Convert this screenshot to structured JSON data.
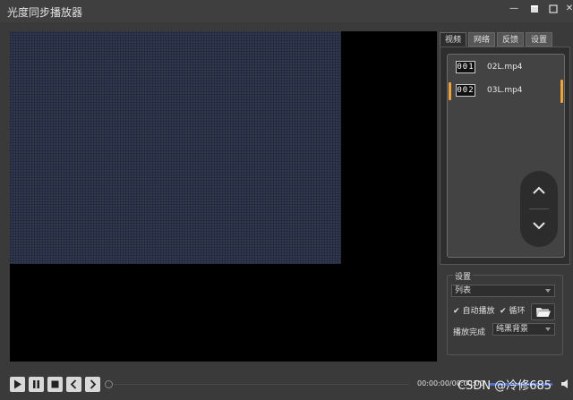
{
  "window": {
    "title": "光度同步播放器"
  },
  "tabs": [
    "视频",
    "网络",
    "反馈",
    "设置"
  ],
  "playlist": {
    "items": [
      {
        "number": "001",
        "name": "02L.mp4",
        "selected": false
      },
      {
        "number": "002",
        "name": "03L.mp4",
        "selected": true
      }
    ]
  },
  "settings": {
    "legend": "设置",
    "mode_select": "列表",
    "autoplay_label": "自动播放",
    "autoplay_checked": true,
    "loop_label": "循环",
    "loop_checked": true,
    "on_finish_label": "播放完成",
    "on_finish_value": "纯黑背景"
  },
  "player": {
    "time_display": "00:00:00/00:00:00"
  },
  "watermark": "CSDN @冷修685",
  "colors": {
    "background": "#3a3a3a",
    "accent": "#f0a23a",
    "volume": "#4a6fd0"
  }
}
